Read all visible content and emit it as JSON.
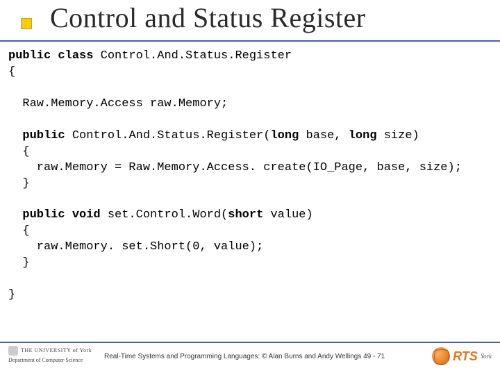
{
  "title": "Control and Status Register",
  "code": {
    "l1_kw": "public class",
    "l1_rest": " Control.And.Status.Register",
    "l2": "{",
    "l3": "  Raw.Memory.Access raw.Memory;",
    "l4a_kw": "public",
    "l4a_mid": " Control.And.Status.Register(",
    "l4a_kw2": "long",
    "l4a_mid2": " base, ",
    "l4a_kw3": "long",
    "l4a_end": " size)",
    "l5": "  {",
    "l6": "    raw.Memory = Raw.Memory.Access. create(IO_Page, base, size);",
    "l7": "  }",
    "l8a_kw": "public void",
    "l8a_mid": " set.Control.Word(",
    "l8a_kw2": "short",
    "l8a_end": " value)",
    "l9": "  {",
    "l10": "    raw.Memory. set.Short(0, value);",
    "l11": "  }",
    "l12": "}"
  },
  "footer": {
    "uoy": "THE UNIVERSITY of York",
    "dept": "Department of Computer Science",
    "citation": "Real-Time Systems and Programming Languages: © Alan Burns and Andy Wellings  49 - 71",
    "rts": "RTS",
    "york": "York"
  }
}
